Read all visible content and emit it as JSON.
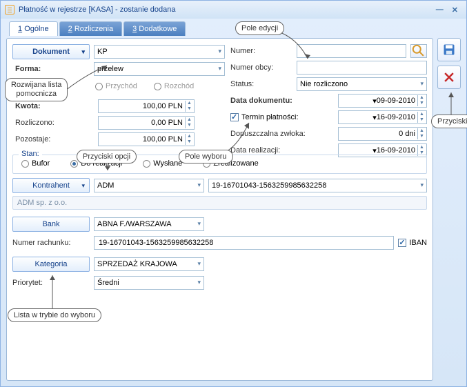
{
  "window": {
    "title": "Płatność w rejestrze [KASA] - zostanie dodana"
  },
  "tabs": {
    "t1_num": "1",
    "t1": "Ogólne",
    "t2_num": "2",
    "t2": "Rozliczenia",
    "t3_num": "3",
    "t3": "Dodatkowe"
  },
  "left": {
    "dokument_btn": "Dokument",
    "dokument_val": "KP",
    "forma_lbl": "Forma:",
    "forma_val": "przelew",
    "przychod_lbl": "Przychód",
    "rozchod_lbl": "Rozchód",
    "kwota_lbl": "Kwota:",
    "kwota_val": "100,00 PLN",
    "rozliczono_lbl": "Rozliczono:",
    "rozliczono_val": "0,00 PLN",
    "pozostaje_lbl": "Pozostaje:",
    "pozostaje_val": "100,00 PLN"
  },
  "right": {
    "numer_lbl": "Numer:",
    "numer_val": "",
    "numerobcy_lbl": "Numer obcy:",
    "numerobcy_val": "",
    "status_lbl": "Status:",
    "status_val": "Nie rozliczono",
    "datadok_lbl": "Data dokumentu:",
    "datadok_val": "09-09-2010",
    "termin_lbl": "Termin płatności:",
    "termin_val": "16-09-2010",
    "zwloka_lbl": "Dopuszczalna zwłoka:",
    "zwloka_val": "0 dni",
    "datareal_lbl": "Data realizacji:",
    "datareal_val": "16-09-2010"
  },
  "stan": {
    "legend": "Stan:",
    "bufor": "Bufor",
    "doreal": "Do realizacji",
    "wyslane": "Wysłane",
    "zreal": "Zrealizowane"
  },
  "kontrahent": {
    "btn": "Kontrahent",
    "val": "ADM",
    "acct": "19-16701043-1563259985632258",
    "company": "ADM sp. z o.o."
  },
  "bank": {
    "btn": "Bank",
    "val": "ABNA F./WARSZAWA",
    "rachlbl": "Numer rachunku:",
    "rachval": "19-16701043-1563259985632258",
    "iban": "IBAN"
  },
  "kategoria": {
    "btn": "Kategoria",
    "val": "SPRZEDAŻ KRAJOWA",
    "priorytet_lbl": "Priorytet:",
    "priorytet_val": "Średni"
  },
  "callouts": {
    "poleedycji": "Pole edycji",
    "rozwijana": "Rozwijana lista\npomocnicza",
    "przyciski_opcji": "Przyciski opcji",
    "pole_wyboru": "Pole wyboru",
    "przyciski": "Przyciski",
    "lista_tryb": "Lista w trybie do wyboru"
  }
}
